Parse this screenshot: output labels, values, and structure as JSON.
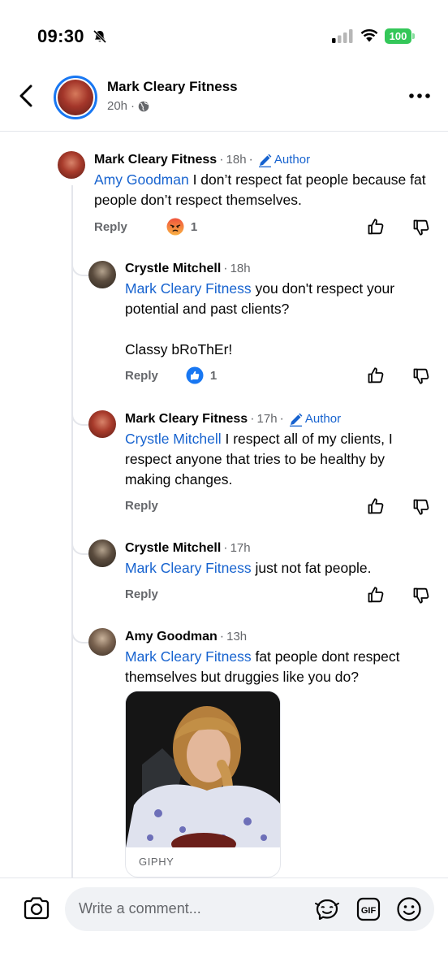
{
  "status_bar": {
    "time": "09:30",
    "battery": "100",
    "battery_color": "#34c759"
  },
  "header": {
    "page_name": "Mark Cleary Fitness",
    "post_age": "20h",
    "separator": "·"
  },
  "colors": {
    "link": "#1763cf",
    "secondary_text": "#65676b",
    "accent": "#1877f2"
  },
  "comments": [
    {
      "author": "Mark Cleary Fitness",
      "time": "18h",
      "author_badge": "Author",
      "mention": "Amy Goodman",
      "text": " I don’t respect fat people because fat people don’t respect themselves.",
      "reply_label": "Reply",
      "reaction": "angry-icon",
      "reaction_count": "1"
    },
    {
      "author": "Crystle Mitchell",
      "time": "18h",
      "mention": "Mark Cleary Fitness",
      "text": " you don't respect your potential and past clients?",
      "text2": "Classy bRoThEr!",
      "reply_label": "Reply",
      "reaction": "like-icon",
      "reaction_count": "1"
    },
    {
      "author": "Mark Cleary Fitness",
      "time": "17h",
      "author_badge": "Author",
      "mention": "Crystle Mitchell",
      "text": " I respect all of my clients, I respect anyone that tries to be healthy by making changes.",
      "reply_label": "Reply"
    },
    {
      "author": "Crystle Mitchell",
      "time": "17h",
      "mention": "Mark Cleary Fitness",
      "text": " just not fat people.",
      "reply_label": "Reply"
    },
    {
      "author": "Amy Goodman",
      "time": "13h",
      "mention": "Mark Cleary Fitness",
      "text": " fat people dont respect themselves but druggies like you do?",
      "gif_label": "GIPHY"
    }
  ],
  "composer": {
    "placeholder": "Write a comment..."
  },
  "icons": [
    "back-arrow-icon",
    "more-icon",
    "globe-icon",
    "pencil-icon",
    "thumbs-up-icon",
    "thumbs-down-icon",
    "camera-icon",
    "sticker-icon",
    "gif-icon",
    "emoji-icon",
    "bell-off-icon",
    "signal-icon",
    "wifi-icon"
  ]
}
